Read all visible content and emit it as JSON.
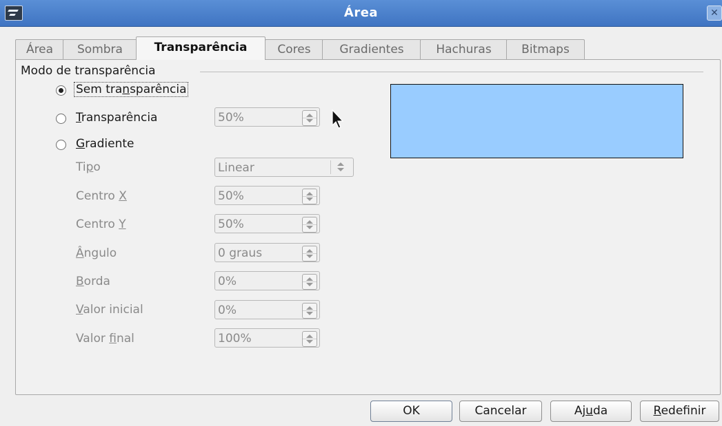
{
  "window": {
    "title": "Área",
    "close_icon": "close-icon"
  },
  "tabs": [
    {
      "label": "Área",
      "active": false
    },
    {
      "label": "Sombra",
      "active": false
    },
    {
      "label": "Transparência",
      "active": true
    },
    {
      "label": "Cores",
      "active": false
    },
    {
      "label": "Gradientes",
      "active": false
    },
    {
      "label": "Hachuras",
      "active": false
    },
    {
      "label": "Bitmaps",
      "active": false
    }
  ],
  "transparency_mode": {
    "group_label": "Modo de transparência",
    "options": [
      {
        "label_pre": "Sem tra",
        "label_key": "n",
        "label_post": "sparência",
        "checked": true
      },
      {
        "label_pre": "",
        "label_key": "T",
        "label_post": "ransparência",
        "checked": false
      },
      {
        "label_pre": "",
        "label_key": "G",
        "label_post": "radiente",
        "checked": false
      }
    ],
    "transparency_value": "50%"
  },
  "gradient": {
    "type": {
      "label_pre": "Ti",
      "label_key": "p",
      "label_post": "o",
      "value": "Linear"
    },
    "center_x": {
      "label_pre": "Centro ",
      "label_key": "X",
      "label_post": "",
      "value": "50%"
    },
    "center_y": {
      "label_pre": "Centro ",
      "label_key": "Y",
      "label_post": "",
      "value": "50%"
    },
    "angle": {
      "label_pre": "",
      "label_key": "Â",
      "label_post": "ngulo",
      "value": "0 graus"
    },
    "border": {
      "label_pre": "",
      "label_key": "B",
      "label_post": "orda",
      "value": "0%"
    },
    "start_value": {
      "label_pre": "",
      "label_key": "V",
      "label_post": "alor inicial",
      "value": "0%"
    },
    "end_value": {
      "label_pre": "Valor ",
      "label_key": "f",
      "label_post": "inal",
      "value": "100%"
    }
  },
  "preview": {
    "fill_color": "#99ccff"
  },
  "buttons": {
    "ok": "OK",
    "cancel": "Cancelar",
    "help_pre": "Aj",
    "help_key": "u",
    "help_post": "da",
    "reset_pre": "",
    "reset_key": "R",
    "reset_post": "edefinir"
  }
}
